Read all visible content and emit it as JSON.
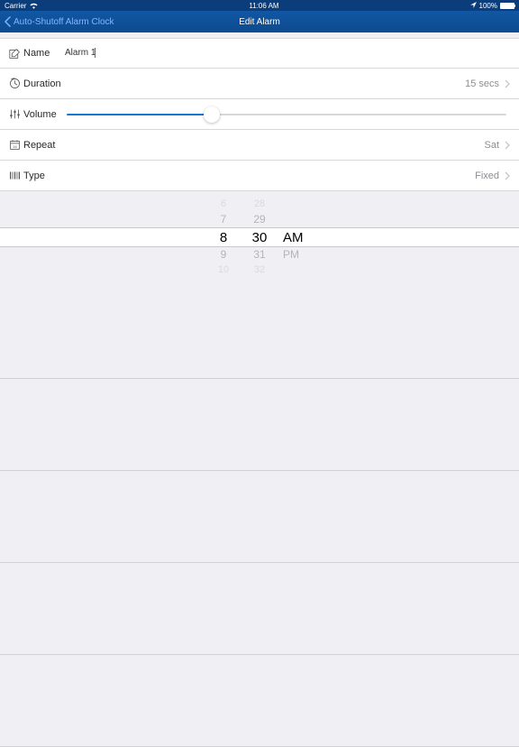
{
  "status_bar": {
    "carrier": "Carrier",
    "time": "11:06 AM",
    "battery_pct": "100%"
  },
  "nav": {
    "back_label": "Auto-Shutoff Alarm Clock",
    "title": "Edit Alarm"
  },
  "rows": {
    "name": {
      "label": "Name",
      "value": "Alarm 1"
    },
    "duration": {
      "label": "Duration",
      "value": "15 secs"
    },
    "volume": {
      "label": "Volume",
      "percent": 33
    },
    "repeat": {
      "label": "Repeat",
      "value": "Sat"
    },
    "type": {
      "label": "Type",
      "value": "Fixed"
    }
  },
  "picker": {
    "hours": [
      "6",
      "7",
      "8",
      "9",
      "10"
    ],
    "minutes": [
      "28",
      "29",
      "30",
      "31",
      "32"
    ],
    "ampm_top": "AM",
    "ampm_bottom": "PM"
  }
}
